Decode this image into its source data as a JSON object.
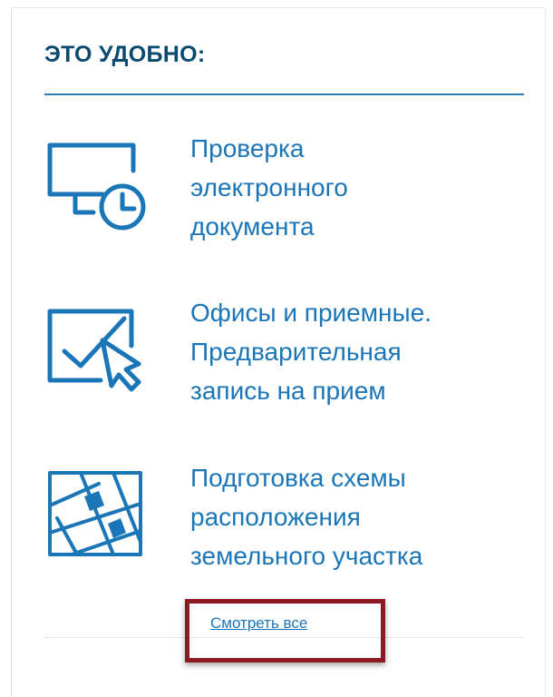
{
  "heading": "ЭТО УДОБНО:",
  "items": [
    {
      "label_lines": [
        "Проверка",
        "электронного",
        "документа"
      ],
      "icon": "monitor-clock-icon"
    },
    {
      "label_lines": [
        "Офисы и приемные.",
        "Предварительная",
        "запись на прием"
      ],
      "icon": "checkmark-cursor-icon"
    },
    {
      "label_lines": [
        "Подготовка схемы",
        "расположения",
        "земельного участка"
      ],
      "icon": "land-plot-grid-icon"
    }
  ],
  "see_all": "Смотреть все",
  "colors": {
    "heading": "#0a4a6e",
    "accent": "#1b76b8",
    "rule": "#2a7fb8",
    "highlight": "#8e1b24"
  }
}
